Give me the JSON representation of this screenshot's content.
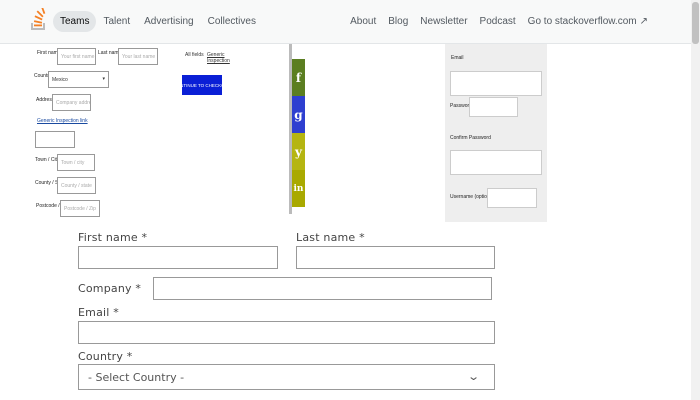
{
  "nav": {
    "left": [
      "Teams",
      "Talent",
      "Advertising",
      "Collectives"
    ],
    "right": [
      "About",
      "Blog",
      "Newsletter",
      "Podcast",
      "Go to stackoverflow.com"
    ],
    "logo_icon": "stackoverflow-logo-icon",
    "external_icon": "external-link-icon"
  },
  "mini_form": {
    "first_name_label": "First name *",
    "first_name_placeholder": "Your first name",
    "last_name_label": "Last name *",
    "last_name_placeholder": "Your last name",
    "country_label": "Country *",
    "country_value": "Mexico",
    "address_label": "Address *",
    "address_placeholder": "Company address",
    "link_label": "Generic Inspection link",
    "town_label": "Town / City *",
    "town_placeholder": "Town / city",
    "county_label": "County / State",
    "county_placeholder": "County / state",
    "postcode_label": "Postcode / ZIP *",
    "postcode_placeholder": "Postcode / Zip",
    "side_link1": "All fields",
    "side_link2": "Generic Inspection",
    "submit_label": "CONTINUE TO CHECKOUT",
    "social": [
      {
        "name": "facebook-icon",
        "glyph": "f",
        "color": "#5b7e21"
      },
      {
        "name": "google-plus-icon",
        "glyph": "g",
        "color": "#2e3fd0"
      },
      {
        "name": "twitter-icon",
        "glyph": "y",
        "color": "#b5b511"
      },
      {
        "name": "linkedin-icon",
        "glyph": "in",
        "color": "#a9a900"
      }
    ]
  },
  "mini_panel": {
    "email_label": "Email",
    "password_label": "Password",
    "confirm_label": "Confirm Password",
    "username_label": "Username (optional)"
  },
  "form": {
    "first_name_label": "First name *",
    "last_name_label": "Last name *",
    "company_label": "Company *",
    "email_label": "Email *",
    "country_label": "Country *",
    "country_value": "- Select Country -"
  }
}
